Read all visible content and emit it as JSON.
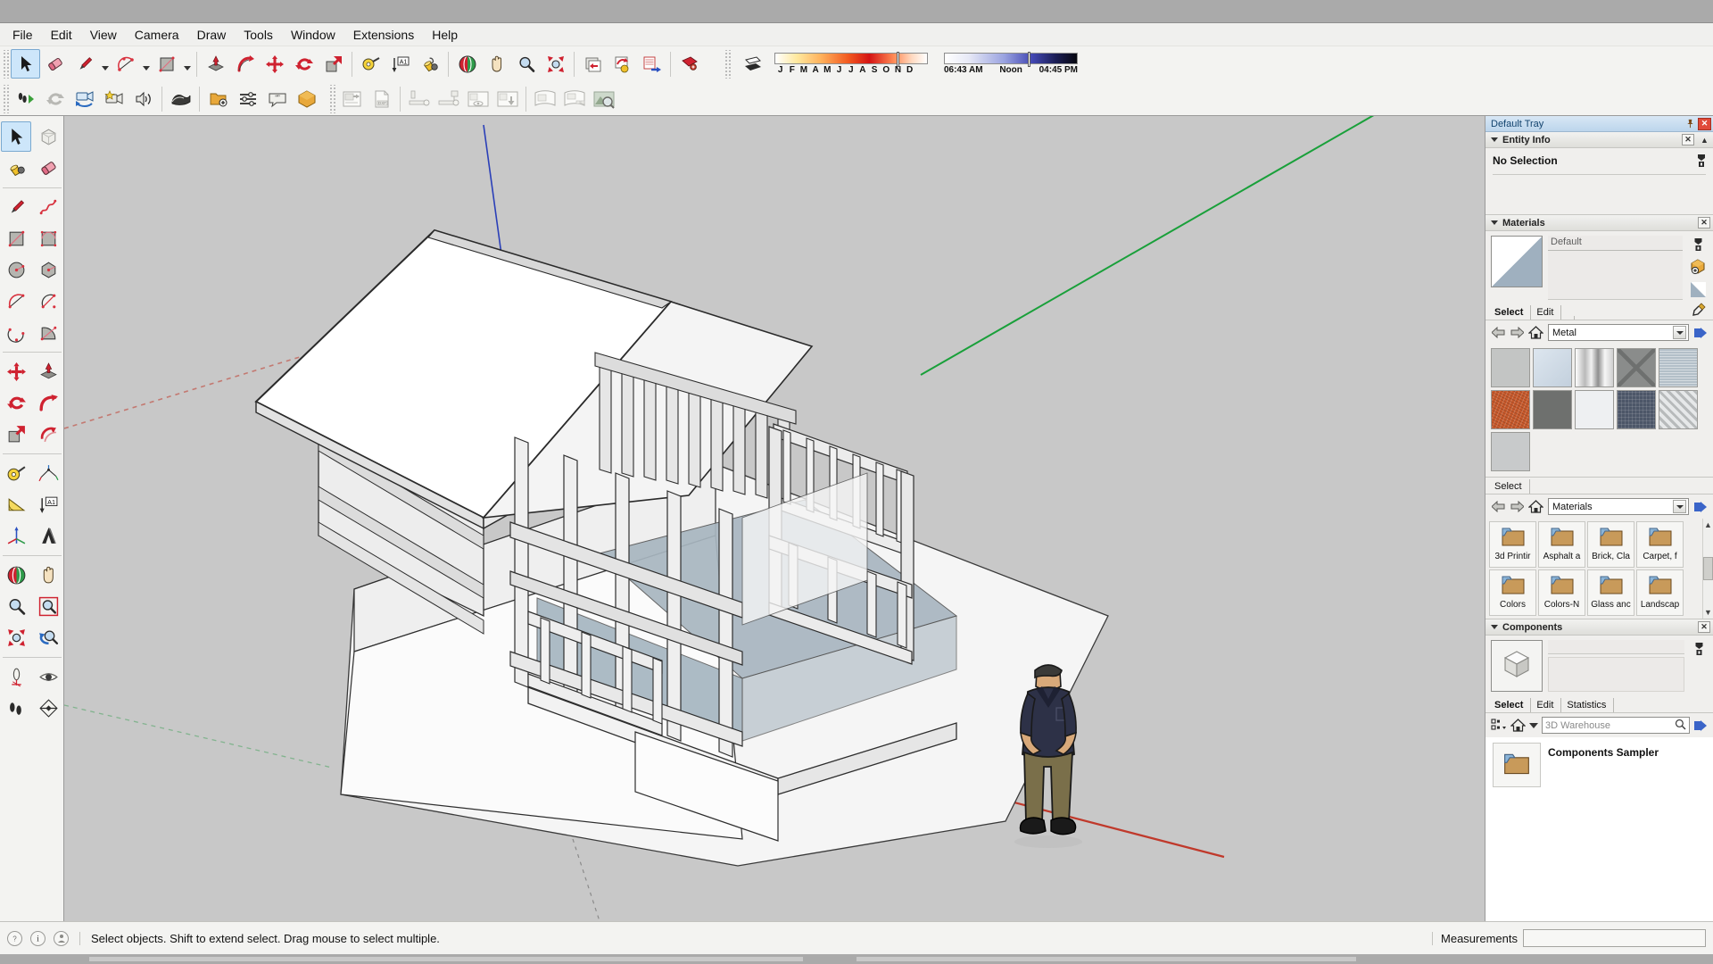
{
  "app": {
    "name": "SketchUp"
  },
  "menubar": {
    "items": [
      {
        "label": "File"
      },
      {
        "label": "Edit"
      },
      {
        "label": "View"
      },
      {
        "label": "Camera"
      },
      {
        "label": "Draw"
      },
      {
        "label": "Tools"
      },
      {
        "label": "Window"
      },
      {
        "label": "Extensions"
      },
      {
        "label": "Help"
      }
    ]
  },
  "toolbar": {
    "row1": [
      {
        "name": "select-tool",
        "icon": "arrow-cursor-icon",
        "active": true
      },
      {
        "name": "eraser-tool",
        "icon": "eraser-icon"
      },
      {
        "name": "line-tool",
        "icon": "pencil-icon",
        "caret": true
      },
      {
        "name": "arc-tool",
        "icon": "arc-icon",
        "caret": true
      },
      {
        "name": "rectangle-tool",
        "icon": "rectangle-icon",
        "caret": true
      },
      {
        "name": "pushpull-tool",
        "icon": "push-pull-icon"
      },
      {
        "name": "followme-tool",
        "icon": "follow-me-icon"
      },
      {
        "name": "move-tool",
        "icon": "move-icon"
      },
      {
        "name": "rotate-tool",
        "icon": "rotate-icon"
      },
      {
        "name": "scale-tool",
        "icon": "scale-icon"
      },
      {
        "name": "tape-measure-tool",
        "icon": "tape-measure-icon"
      },
      {
        "name": "text-tool",
        "icon": "text-a1-icon"
      },
      {
        "name": "paint-bucket-tool",
        "icon": "paint-bucket-icon"
      },
      {
        "name": "orbit-tool",
        "icon": "orbit-icon"
      },
      {
        "name": "pan-tool",
        "icon": "pan-hand-icon"
      },
      {
        "name": "zoom-tool",
        "icon": "magnifier-icon"
      },
      {
        "name": "zoom-extents-tool",
        "icon": "zoom-extents-icon"
      },
      {
        "name": "previous-scene",
        "icon": "scene-prev-icon"
      },
      {
        "name": "update-scene",
        "icon": "scene-update-icon"
      },
      {
        "name": "next-scene",
        "icon": "scene-next-icon"
      },
      {
        "name": "section-plane-tool",
        "icon": "section-plane-icon"
      }
    ],
    "row2": [
      {
        "name": "walk-tool",
        "icon": "walk-play-icon"
      },
      {
        "name": "sync-button",
        "icon": "sync-arrows-icon"
      },
      {
        "name": "add-scene-camera",
        "icon": "camera-orbit-icon"
      },
      {
        "name": "favorite-camera",
        "icon": "camera-star-icon"
      },
      {
        "name": "sound-button",
        "icon": "speaker-icon"
      },
      {
        "name": "sandbox-tool",
        "icon": "sandbox-icon"
      },
      {
        "name": "add-folder",
        "icon": "folder-plus-icon"
      },
      {
        "name": "settings-sliders",
        "icon": "sliders-icon"
      },
      {
        "name": "comment-button",
        "icon": "speech-bubble-icon"
      },
      {
        "name": "warehouse-button",
        "icon": "warehouse-badge-icon"
      },
      {
        "name": "send-to-layout",
        "icon": "send-layout-icon",
        "disabled": true
      },
      {
        "name": "export-dxf",
        "icon": "dxf-page-icon",
        "disabled": true
      },
      {
        "name": "dim-linear",
        "icon": "dimension-linear-icon",
        "disabled": true
      },
      {
        "name": "dim-flag",
        "icon": "dimension-flag-icon",
        "disabled": true
      },
      {
        "name": "view-preview",
        "icon": "view-preview-icon",
        "disabled": true
      },
      {
        "name": "view-download",
        "icon": "view-download-icon",
        "disabled": true
      },
      {
        "name": "page-single",
        "icon": "page-single-icon",
        "disabled": true
      },
      {
        "name": "page-multi",
        "icon": "page-multi-icon",
        "disabled": true
      },
      {
        "name": "photo-inspect",
        "icon": "photo-magnifier-icon",
        "disabled": true
      }
    ],
    "shadows": {
      "toggle_name": "shadow-toggle-icon",
      "month_labels": [
        "J",
        "F",
        "M",
        "A",
        "M",
        "J",
        "J",
        "A",
        "S",
        "O",
        "N",
        "D"
      ],
      "month_thumb_pct": 80,
      "time_labels": {
        "start": "06:43 AM",
        "middle": "Noon",
        "end": "04:45 PM"
      },
      "time_thumb_pct": 63
    }
  },
  "large_tool_set": {
    "groups": [
      [
        {
          "name": "select-tool",
          "icon": "arrow-cursor-icon",
          "active": true
        },
        {
          "name": "make-component-tool",
          "icon": "make-component-icon"
        },
        {
          "name": "paint-bucket-tool",
          "icon": "paint-bucket-icon"
        },
        {
          "name": "eraser-tool",
          "icon": "eraser-icon"
        }
      ],
      [
        {
          "name": "line-tool",
          "icon": "pencil-icon"
        },
        {
          "name": "freehand-tool",
          "icon": "freehand-icon"
        },
        {
          "name": "rectangle-tool",
          "icon": "rectangle-icon"
        },
        {
          "name": "rotated-rectangle-tool",
          "icon": "rotated-rectangle-icon"
        },
        {
          "name": "circle-tool",
          "icon": "circle-icon"
        },
        {
          "name": "polygon-tool",
          "icon": "polygon-icon"
        },
        {
          "name": "arc-tool",
          "icon": "arc-icon"
        },
        {
          "name": "two-point-arc-tool",
          "icon": "two-point-arc-icon"
        },
        {
          "name": "three-point-arc-tool",
          "icon": "three-point-arc-icon"
        },
        {
          "name": "pie-tool",
          "icon": "pie-icon"
        }
      ],
      [
        {
          "name": "move-tool",
          "icon": "move-icon"
        },
        {
          "name": "pushpull-tool",
          "icon": "push-pull-icon"
        },
        {
          "name": "rotate-tool",
          "icon": "rotate-icon"
        },
        {
          "name": "followme-tool",
          "icon": "follow-me-icon"
        },
        {
          "name": "scale-tool",
          "icon": "scale-icon"
        },
        {
          "name": "offset-tool",
          "icon": "offset-icon"
        }
      ],
      [
        {
          "name": "tape-measure-tool",
          "icon": "tape-measure-icon"
        },
        {
          "name": "dimension-tool",
          "icon": "dimension-icon"
        },
        {
          "name": "protractor-tool",
          "icon": "protractor-icon"
        },
        {
          "name": "text-tool",
          "icon": "text-a1-icon"
        },
        {
          "name": "axes-tool",
          "icon": "axes-icon"
        },
        {
          "name": "three-d-text-tool",
          "icon": "3d-text-icon"
        }
      ],
      [
        {
          "name": "orbit-tool",
          "icon": "orbit-icon"
        },
        {
          "name": "pan-tool",
          "icon": "pan-hand-icon"
        },
        {
          "name": "zoom-tool",
          "icon": "magnifier-icon"
        },
        {
          "name": "zoom-window-tool",
          "icon": "zoom-window-icon"
        },
        {
          "name": "zoom-extents-tool",
          "icon": "zoom-extents-icon"
        },
        {
          "name": "previous-view-tool",
          "icon": "previous-view-icon"
        }
      ],
      [
        {
          "name": "position-camera-tool",
          "icon": "position-camera-icon"
        },
        {
          "name": "look-around-tool",
          "icon": "eye-icon"
        },
        {
          "name": "walk-tool",
          "icon": "walk-icon"
        },
        {
          "name": "section-plane-tool",
          "icon": "section-plane-icon"
        }
      ]
    ]
  },
  "canvas": {
    "background_color": "#c8c8c8",
    "ground_color": "#f5f5f5",
    "axis_green": "#19a03a",
    "axis_red": "#c0392b",
    "axis_blue": "#2a3fb8",
    "model_description": "Wood-framed cabin with gable roof, stud walls and deck railing",
    "scale_figure": {
      "name": "scale-figure-man",
      "shirt_color": "#2d3147",
      "pants_color": "#7a6f4a",
      "skin_color": "#d8a97a",
      "shoe_color": "#1a1a1a"
    }
  },
  "tray": {
    "title": "Default Tray",
    "pin_icon": "pin-icon",
    "close_icon": "close-icon",
    "entity_info": {
      "title": "Entity Info",
      "selection_text": "No Selection",
      "close_icon": "close-icon",
      "collapse_icon": "chevron-up-icon",
      "toggle_icon": "triangle-down-icon"
    },
    "materials": {
      "title": "Materials",
      "close_icon": "close-icon",
      "toggle_icon": "triangle-down-icon",
      "current_name": "Default",
      "tabs": [
        {
          "label": "Select",
          "selected": true
        },
        {
          "label": "Edit",
          "selected": false
        }
      ],
      "eyedropper_icon": "eyedropper-icon",
      "collection": "Metal",
      "nav": {
        "back_icon": "arrow-left-icon",
        "forward_icon": "arrow-right-icon",
        "home_icon": "home-icon",
        "details_icon": "arrow-details-icon"
      },
      "swatches": [
        {
          "name": "aluminum",
          "color": "#c3c5c4",
          "pattern": "flat"
        },
        {
          "name": "galvanized",
          "color": "#ced8e2",
          "pattern": "flat"
        },
        {
          "name": "brushed-metal",
          "color": "#e8e8e8",
          "pattern": "vertical-gradient"
        },
        {
          "name": "metal-panel",
          "color": "#8a8c8b",
          "pattern": "x-panel"
        },
        {
          "name": "corrugated-zinc",
          "color": "#b3bfc8",
          "pattern": "noise"
        },
        {
          "name": "rusted-metal",
          "color": "#c85a2c",
          "pattern": "noise"
        },
        {
          "name": "dark-steel",
          "color": "#6e706e",
          "pattern": "flat"
        },
        {
          "name": "white-metal",
          "color": "#eef0f2",
          "pattern": "flat"
        },
        {
          "name": "blue-steel-mesh",
          "color": "#4c5668",
          "pattern": "mesh"
        },
        {
          "name": "diamond-plate",
          "color": "#d7d9da",
          "pattern": "diamond"
        },
        {
          "name": "light-aluminum",
          "color": "#c8cacb",
          "pattern": "flat"
        }
      ]
    },
    "materials_browser": {
      "tab_label": "Select",
      "collection": "Materials",
      "nav": {
        "back_icon": "arrow-left-icon",
        "forward_icon": "arrow-right-icon",
        "home_icon": "home-icon",
        "details_icon": "arrow-details-icon"
      },
      "folders": [
        {
          "label": "3d Printir",
          "icon": "folder-icon"
        },
        {
          "label": "Asphalt a",
          "icon": "folder-icon"
        },
        {
          "label": "Brick, Cla",
          "icon": "folder-icon"
        },
        {
          "label": "Carpet, f",
          "icon": "folder-icon"
        },
        {
          "label": "Colors",
          "icon": "folder-icon"
        },
        {
          "label": "Colors-N",
          "icon": "folder-icon"
        },
        {
          "label": "Glass anc",
          "icon": "folder-icon"
        },
        {
          "label": "Landscap",
          "icon": "folder-icon"
        }
      ],
      "scroll_up_icon": "chevron-up-icon",
      "scroll_down_icon": "chevron-down-icon"
    },
    "components": {
      "title": "Components",
      "close_icon": "close-icon",
      "toggle_icon": "triangle-down-icon",
      "preview_icon": "cube-icon",
      "name_value": "",
      "description_value": "",
      "tabs": [
        {
          "label": "Select",
          "selected": true
        },
        {
          "label": "Edit",
          "selected": false
        },
        {
          "label": "Statistics",
          "selected": false
        }
      ],
      "view_options_icon": "view-options-icon",
      "home_icon": "home-icon",
      "dropdown_icon": "triangle-down-icon",
      "search_placeholder": "3D Warehouse",
      "search_icon": "search-icon",
      "details_icon": "arrow-details-icon",
      "result": {
        "label": "Components Sampler",
        "icon": "folder-icon"
      }
    }
  },
  "statusbar": {
    "icons": [
      {
        "name": "help-icon",
        "glyph": "?"
      },
      {
        "name": "info-icon",
        "glyph": "i"
      },
      {
        "name": "account-icon",
        "glyph": "●"
      }
    ],
    "message": "Select objects. Shift to extend select. Drag mouse to select multiple.",
    "measurements_label": "Measurements",
    "measurements_value": ""
  }
}
